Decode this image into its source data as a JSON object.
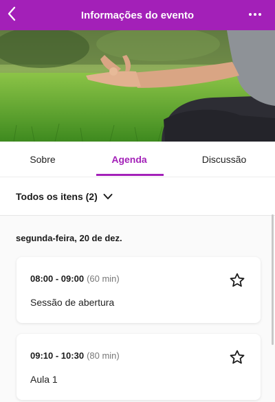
{
  "header": {
    "title": "Informações do evento",
    "back_icon": "chevron-left-icon",
    "more_icon": "more-horizontal-icon",
    "color": "#a320b8"
  },
  "hero": {
    "icon": "event-cover-image"
  },
  "tabs": [
    {
      "label": "Sobre",
      "active": false
    },
    {
      "label": "Agenda",
      "active": true
    },
    {
      "label": "Discussão",
      "active": false
    }
  ],
  "filter": {
    "label": "Todos os itens (2)",
    "icon": "chevron-down-icon"
  },
  "agenda": {
    "date": "segunda-feira, 20 de dez.",
    "items": [
      {
        "time": "08:00 - 09:00",
        "duration": "(60 min)",
        "title": "Sessão de abertura",
        "icon": "star-outline-icon"
      },
      {
        "time": "09:10 - 10:30",
        "duration": "(80 min)",
        "title": "Aula 1",
        "icon": "star-outline-icon"
      }
    ]
  }
}
